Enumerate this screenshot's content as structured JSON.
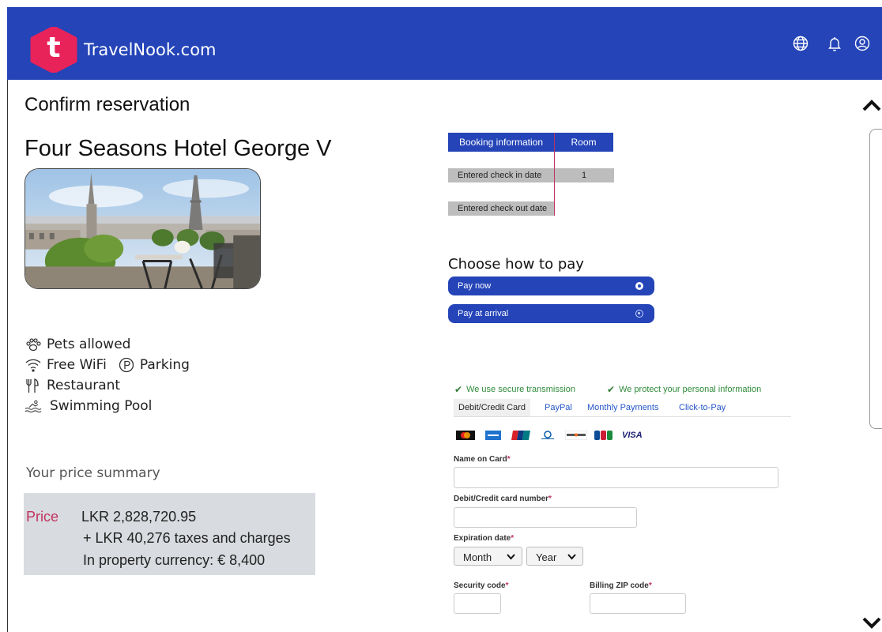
{
  "header": {
    "logo_letter": "t",
    "brand": "TravelNook.com",
    "icons": [
      "globe-icon",
      "bell-icon",
      "account-icon"
    ],
    "brand_color": "#2444b8",
    "logo_color": "#e8235a"
  },
  "page": {
    "title": "Confirm reservation",
    "hotel_name": "Four Seasons Hotel George V"
  },
  "amenities": {
    "pets": "Pets allowed",
    "wifi": "Free WiFi",
    "parking": "Parking",
    "restaurant": "Restaurant",
    "pool": "Swimming Pool"
  },
  "price_summary": {
    "title": "Your price summary",
    "label": "Price",
    "amount": "LKR 2,828,720.95",
    "taxes": "+ LKR 40,276 taxes and charges",
    "property_currency": "In property currency: € 8,400"
  },
  "booking_table": {
    "headers": [
      "Booking information",
      "Room"
    ],
    "rows": [
      {
        "label": "Entered check in date",
        "value": "1"
      },
      {
        "label": "Entered check out date",
        "value": ""
      }
    ]
  },
  "payment_choice": {
    "title": "Choose how to pay",
    "options": [
      {
        "label": "Pay now",
        "selected": true
      },
      {
        "label": "Pay at arrival",
        "selected": false
      }
    ]
  },
  "security": {
    "note1": "We use secure transmission",
    "note2": "We protect your personal information"
  },
  "payment_tabs": [
    {
      "label": "Debit/Credit Card",
      "active": true
    },
    {
      "label": "PayPal",
      "active": false
    },
    {
      "label": "Monthly Payments",
      "active": false
    },
    {
      "label": "Click-to-Pay",
      "active": false
    }
  ],
  "card_logos": [
    "mastercard",
    "amex",
    "unionpay",
    "diners",
    "discover",
    "jcb",
    "visa"
  ],
  "card_visa_text": "VISA",
  "form": {
    "name_label": "Name on Card",
    "number_label": "Debit/Credit card number",
    "expiry_label": "Expiration date",
    "month": "Month",
    "year": "Year",
    "security_label": "Security code",
    "zip_label": "Billing ZIP code",
    "required_mark": "*"
  }
}
